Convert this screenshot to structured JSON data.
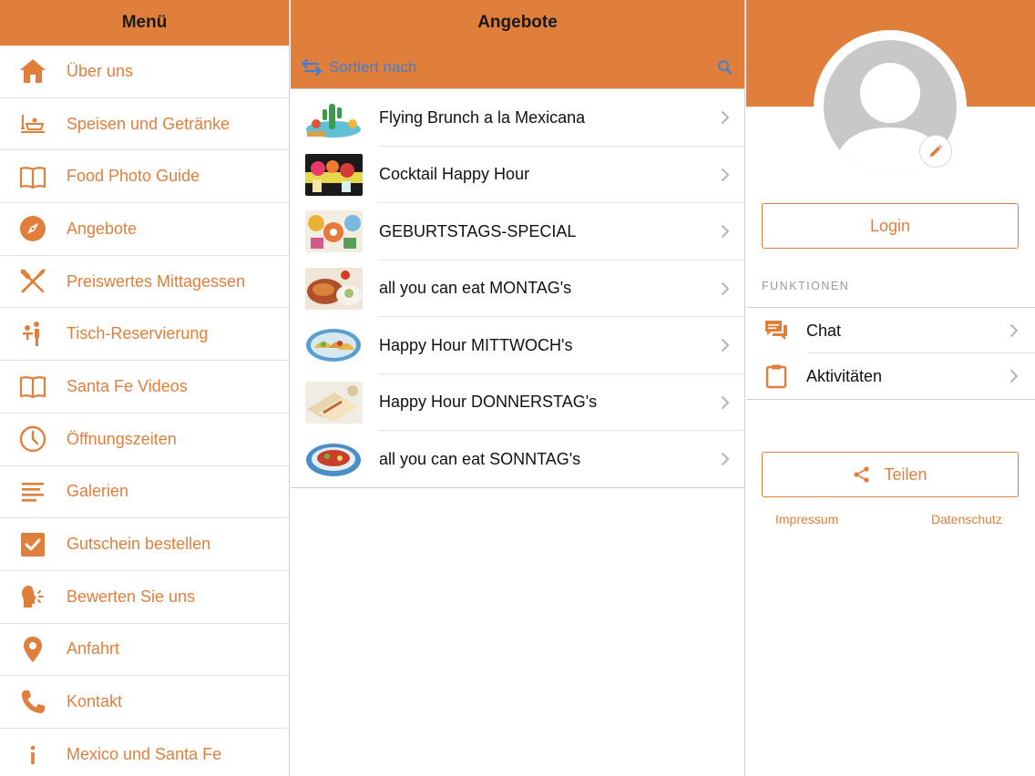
{
  "colors": {
    "accent": "#e07f3c",
    "link_blue": "#3d7fd6"
  },
  "menu": {
    "title": "Menü",
    "items": [
      {
        "label": "Über uns",
        "icon": "home-icon"
      },
      {
        "label": "Speisen und Getränke",
        "icon": "food-drinks-icon"
      },
      {
        "label": "Food Photo Guide",
        "icon": "book-icon"
      },
      {
        "label": "Angebote",
        "icon": "compass-icon"
      },
      {
        "label": "Preiswertes Mittagessen",
        "icon": "fork-knife-icon"
      },
      {
        "label": "Tisch-Reservierung",
        "icon": "reservation-icon"
      },
      {
        "label": "Santa Fe Videos",
        "icon": "book-icon"
      },
      {
        "label": "Öffnungszeiten",
        "icon": "clock-icon"
      },
      {
        "label": "Galerien",
        "icon": "list-icon"
      },
      {
        "label": "Gutschein bestellen",
        "icon": "checkbox-icon"
      },
      {
        "label": "Bewerten Sie uns",
        "icon": "rate-icon"
      },
      {
        "label": "Anfahrt",
        "icon": "location-pin-icon"
      },
      {
        "label": "Kontakt",
        "icon": "phone-icon"
      },
      {
        "label": "Mexico und Santa Fe",
        "icon": "info-icon"
      }
    ]
  },
  "offers": {
    "title": "Angebote",
    "sort_label": "Sortiert nach",
    "items": [
      {
        "label": "Flying Brunch a la Mexicana",
        "thumb": "cactus-thumbnail"
      },
      {
        "label": "Cocktail Happy Hour",
        "thumb": "cocktail-thumbnail"
      },
      {
        "label": "GEBURTSTAGS-SPECIAL",
        "thumb": "party-thumbnail"
      },
      {
        "label": "all you can eat MONTAG's",
        "thumb": "food-plate-thumbnail"
      },
      {
        "label": "Happy Hour MITTWOCH's",
        "thumb": "tacos-thumbnail"
      },
      {
        "label": "Happy Hour DONNERSTAG's",
        "thumb": "wraps-thumbnail"
      },
      {
        "label": "all you can eat SONNTAG's",
        "thumb": "dish-thumbnail"
      }
    ]
  },
  "profile": {
    "login_label": "Login",
    "section_title": "FUNKTIONEN",
    "functions": [
      {
        "label": "Chat",
        "icon": "chat-icon"
      },
      {
        "label": "Aktivitäten",
        "icon": "clipboard-icon"
      }
    ],
    "share_label": "Teilen",
    "imprint_label": "Impressum",
    "privacy_label": "Datenschutz"
  }
}
